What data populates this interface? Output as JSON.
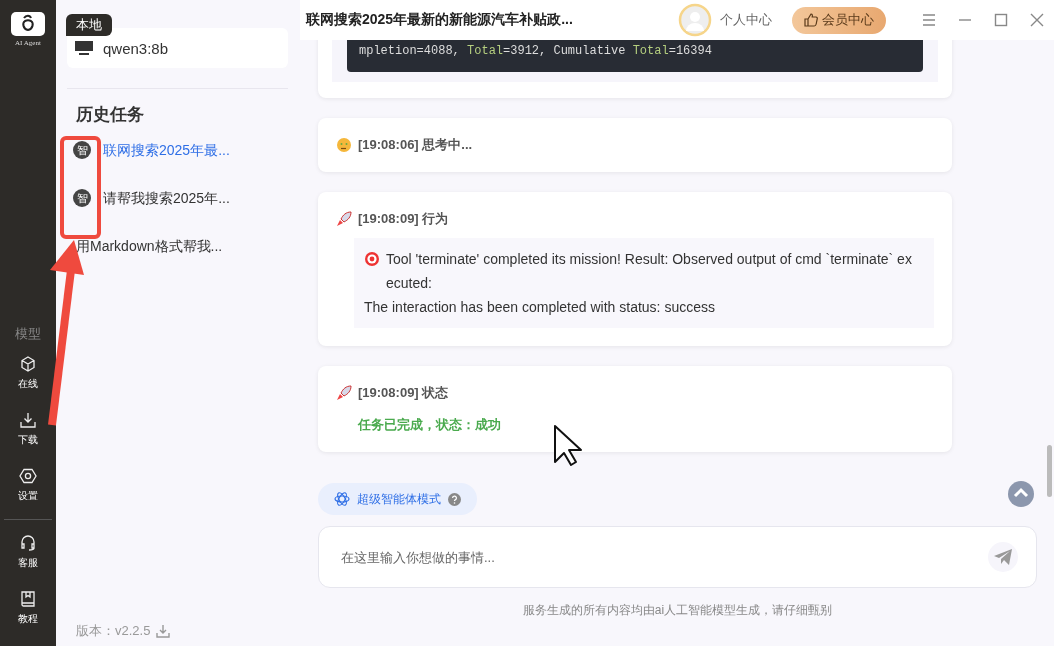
{
  "rail": {
    "logo_caption": "AI Agent",
    "section_label": "模型",
    "items": [
      {
        "label": "在线",
        "kind": "cube",
        "divider_before": false
      },
      {
        "label": "下载",
        "kind": "download",
        "divider_before": false
      },
      {
        "label": "设置",
        "kind": "gear",
        "divider_before": false
      },
      {
        "label": "客服",
        "kind": "headset",
        "divider_before": true
      },
      {
        "label": "教程",
        "kind": "book",
        "divider_before": false
      }
    ]
  },
  "sidebar": {
    "model_tag": "本地",
    "model": "qwen3:8b",
    "history_title": "历史任务",
    "history": [
      {
        "title": "联网搜索2025年最...",
        "badge": "智",
        "selected": true
      },
      {
        "title": "请帮我搜索2025年...",
        "badge": "智",
        "selected": false
      },
      {
        "title": "用Markdown格式帮我...",
        "selected": false
      }
    ],
    "version": "版本：v2.2.5"
  },
  "header": {
    "title": "联网搜索2025年最新的新能源汽车补贴政...",
    "profile": "个人中心",
    "vip": "会员中心"
  },
  "feed": [
    {
      "kind": "code",
      "tokens": [
        {
          "text": "mpletion=4088, ",
          "kind": "plain"
        },
        {
          "text": "Total",
          "kind": "key"
        },
        {
          "text": "=3912, Cumulative ",
          "kind": "plain"
        },
        {
          "text": "Total",
          "kind": "key"
        },
        {
          "text": "=16394",
          "kind": "plain"
        }
      ]
    },
    {
      "kind": "thinking",
      "time": "[19:08:06]",
      "title": "思考中..."
    },
    {
      "kind": "action",
      "time": "[19:08:09]",
      "title": "行为",
      "lines": [
        "Tool 'terminate' completed its mission! Result: Observed output of cmd `terminate` executed:",
        "The interaction has been completed with status: success"
      ]
    },
    {
      "kind": "status",
      "time": "[19:08:09]",
      "title": "状态",
      "result": "任务已完成，状态：成功"
    }
  ],
  "mode": {
    "label": "超级智能体模式"
  },
  "input": {
    "placeholder": "在这里输入你想做的事情..."
  },
  "footer": "服务生成的所有内容均由ai人工智能模型生成，请仔细甄别"
}
